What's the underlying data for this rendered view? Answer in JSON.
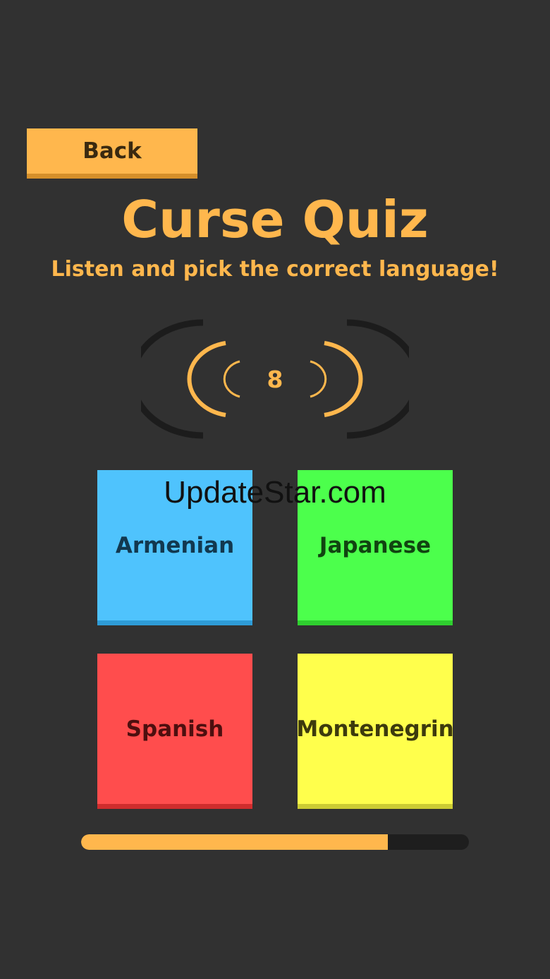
{
  "back_label": "Back",
  "title": "Curse Quiz",
  "subtitle": "Listen and pick the correct language!",
  "speaker": {
    "icon": "sound-waves-icon",
    "countdown": "8"
  },
  "answers": [
    {
      "label": "Armenian",
      "color": "#4fc3fd"
    },
    {
      "label": "Japanese",
      "color": "#4cff4c"
    },
    {
      "label": "Spanish",
      "color": "#ff4d4d"
    },
    {
      "label": "Montenegrin",
      "color": "#ffff4c"
    }
  ],
  "progress": {
    "fraction": 0.79
  },
  "watermark": "UpdateStar.com",
  "colors": {
    "background": "#313131",
    "accent": "#ffb74d",
    "track": "#1e1e1e"
  }
}
